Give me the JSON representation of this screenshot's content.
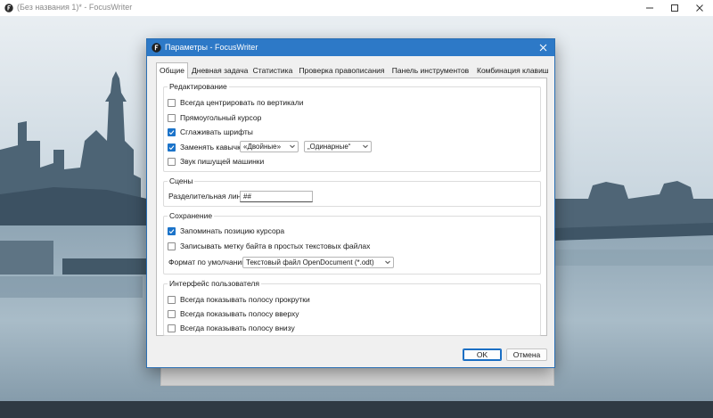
{
  "app": {
    "title": "(Без названия 1)* - FocusWriter"
  },
  "dialog": {
    "title": "Параметры - FocusWriter",
    "tabs": [
      {
        "label": "Общие",
        "active": true
      },
      {
        "label": "Дневная задача",
        "active": false
      },
      {
        "label": "Статистика",
        "active": false
      },
      {
        "label": "Проверка правописания",
        "active": false
      },
      {
        "label": "Панель инструментов",
        "active": false
      },
      {
        "label": "Комбинация клавиш",
        "active": false
      }
    ],
    "editing": {
      "title": "Редактирование",
      "center_vertically": "Всегда центрировать по вертикали",
      "block_cursor": "Прямоугольный курсор",
      "smooth_fonts": "Сглаживать шрифты",
      "replace_quotes": "Заменять кавычки:",
      "double_quotes": "«Двойные»",
      "single_quotes": "„Одинарные“",
      "typewriter_sound": "Звук пишущей машинки"
    },
    "scenes": {
      "title": "Сцены",
      "divider_label": "Разделительная линия:",
      "divider_value": "##"
    },
    "saving": {
      "title": "Сохранение",
      "remember_cursor": "Запоминать позицию курсора",
      "write_bom": "Записывать метку байта в простых текстовых файлах",
      "default_format_label": "Формат по умолчанию:",
      "default_format_value": "Текстовый файл OpenDocument (*.odt)"
    },
    "ui": {
      "title": "Интерфейс пользователя",
      "show_scrollbar": "Всегда показывать полосу прокрутки",
      "show_header": "Всегда показывать полосу вверху",
      "show_footer": "Всегда показывать полосу внизу"
    },
    "buttons": {
      "ok": "OK",
      "cancel": "Отмена"
    }
  },
  "colors": {
    "accent": "#2d79c7",
    "checkbox_checked": "#1b73c9"
  }
}
